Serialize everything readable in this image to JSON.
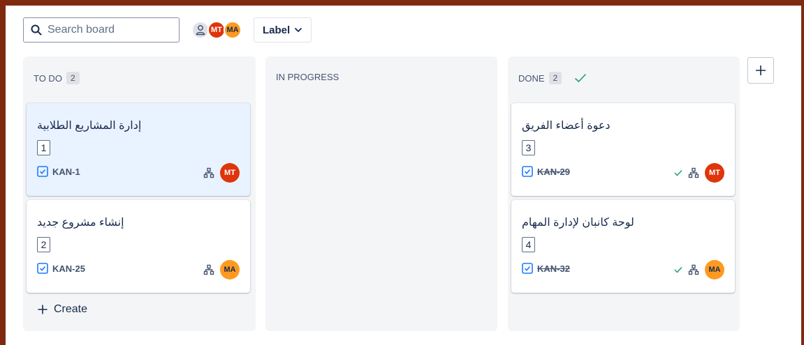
{
  "search": {
    "placeholder": "Search board",
    "value": ""
  },
  "avatars": [
    {
      "name": "generic-user",
      "initials": ""
    },
    {
      "name": "MT",
      "initials": "MT",
      "color": "#de350b"
    },
    {
      "name": "MA",
      "initials": "MA",
      "color": "#ff991f"
    }
  ],
  "filters": {
    "label_button": "Label"
  },
  "columns": [
    {
      "title": "TO DO",
      "count": "2",
      "cards": [
        {
          "title": "إدارة المشاريع الطلابية",
          "number": "1",
          "key": "KAN-1",
          "assignee": "MT",
          "done": false
        },
        {
          "title": "إنشاء مشروع جديد",
          "number": "2",
          "key": "KAN-25",
          "assignee": "MA",
          "done": false
        }
      ],
      "create_label": "Create"
    },
    {
      "title": "IN PROGRESS",
      "count": "",
      "cards": []
    },
    {
      "title": "DONE",
      "count": "2",
      "cards": [
        {
          "title": "دعوة أعضاء الفريق",
          "number": "3",
          "key": "KAN-29",
          "assignee": "MT",
          "done": true
        },
        {
          "title": "لوحة كانبان لإدارة المهام",
          "number": "4",
          "key": "KAN-32",
          "assignee": "MA",
          "done": true
        }
      ]
    }
  ],
  "colors": {
    "frame": "#7f2a0e",
    "checkbox_blue": "#1d7afc",
    "done_green": "#22a06b",
    "mt": "#de350b",
    "ma": "#ff991f"
  },
  "icons": [
    "search-icon",
    "person-icon",
    "chevron-down-icon",
    "checkbox-icon",
    "subtasks-icon",
    "check-icon",
    "plus-icon"
  ]
}
